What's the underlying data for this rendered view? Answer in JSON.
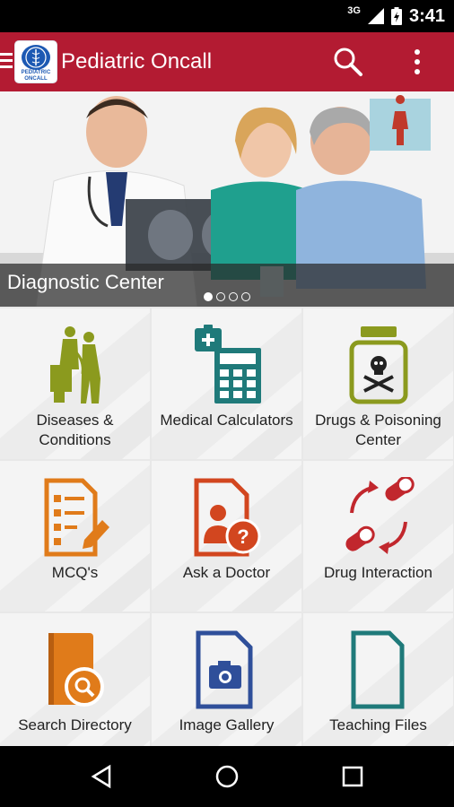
{
  "status": {
    "network": "3G",
    "time": "3:41"
  },
  "appbar": {
    "title": "Pediatric Oncall",
    "logo_line1": "PEDIATRIC",
    "logo_line2": "ONCALL"
  },
  "banner": {
    "caption": "Diagnostic Center",
    "slide_index": 1,
    "slide_count": 4
  },
  "tiles": [
    {
      "line1": "Diseases &",
      "line2": "Conditions",
      "icon": "doctor-patient-icon",
      "color": "#8b9a1e"
    },
    {
      "line1": "Medical Calculators",
      "line2": "",
      "icon": "calculator-icon",
      "color": "#1f7a7a"
    },
    {
      "line1": "Drugs & Poisoning",
      "line2": "Center",
      "icon": "poison-bottle-icon",
      "color": "#8b9a1e"
    },
    {
      "line1": "MCQ's",
      "line2": "",
      "icon": "checklist-icon",
      "color": "#e07b1a"
    },
    {
      "line1": "Ask a Doctor",
      "line2": "",
      "icon": "ask-doctor-icon",
      "color": "#d2461f"
    },
    {
      "line1": "Drug Interaction",
      "line2": "",
      "icon": "pill-interaction-icon",
      "color": "#c1272d"
    },
    {
      "line1": "Search Directory",
      "line2": "",
      "icon": "book-search-icon",
      "color": "#e07b1a"
    },
    {
      "line1": "Image Gallery",
      "line2": "",
      "icon": "camera-file-icon",
      "color": "#2f4f9a"
    },
    {
      "line1": "Teaching Files",
      "line2": "",
      "icon": "document-icon",
      "color": "#1f7a7a"
    }
  ]
}
